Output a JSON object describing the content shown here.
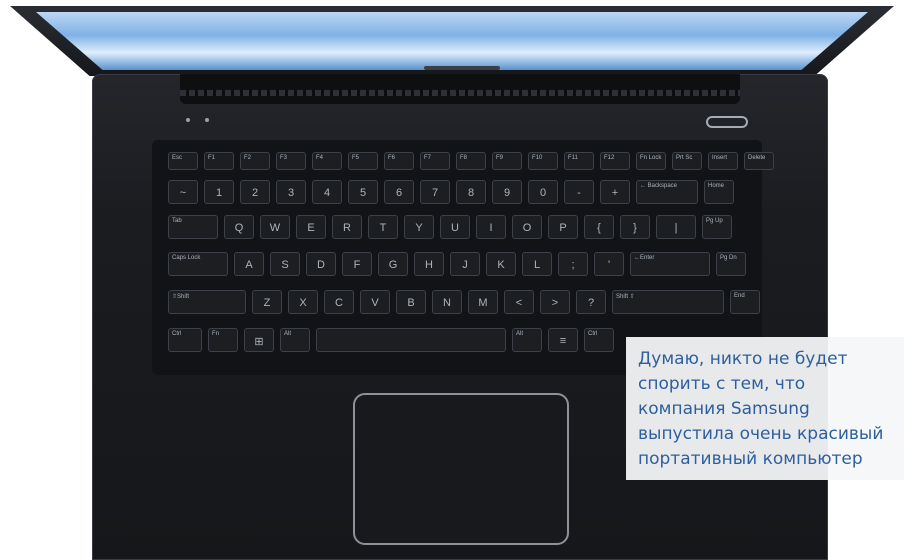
{
  "image": {
    "subject": "laptop-keyboard-top-view",
    "colors": {
      "chassis": "#1a1c20",
      "screen": "#8fbbe8",
      "caption_text": "#2d5f9e",
      "caption_bg": "#f5f7f9"
    }
  },
  "caption": {
    "lines": [
      "Думаю, никто не будет",
      "спорить с тем, что",
      "компания Samsung",
      "выпустила очень красивый",
      "портативный компьютер"
    ]
  },
  "keyboard": {
    "row0": [
      "Esc",
      "F1",
      "F2",
      "F3",
      "F4",
      "F5",
      "F6",
      "F7",
      "F8",
      "F9",
      "F10",
      "F11",
      "F12",
      "Fn Lock",
      "Prt Sc",
      "Insert",
      "Delete"
    ],
    "row1": [
      "~",
      "1",
      "2",
      "3",
      "4",
      "5",
      "6",
      "7",
      "8",
      "9",
      "0",
      "-",
      "+",
      "← Backspace",
      "Home"
    ],
    "row2": [
      "Tab",
      "Q",
      "W",
      "E",
      "R",
      "T",
      "Y",
      "U",
      "I",
      "O",
      "P",
      "{",
      "}",
      "|",
      "Pg Up"
    ],
    "row3": [
      "Caps Lock",
      "A",
      "S",
      "D",
      "F",
      "G",
      "H",
      "J",
      "K",
      "L",
      ";",
      "'",
      "←Enter",
      "Pg Dn"
    ],
    "row4": [
      "⇧Shift",
      "Z",
      "X",
      "C",
      "V",
      "B",
      "N",
      "M",
      "<",
      ">",
      "?",
      "Shift ⇧",
      "End"
    ],
    "row5": [
      "Ctrl",
      "Fn",
      "⊞",
      "Alt",
      "",
      "Alt",
      "≡",
      "Ctrl"
    ]
  }
}
